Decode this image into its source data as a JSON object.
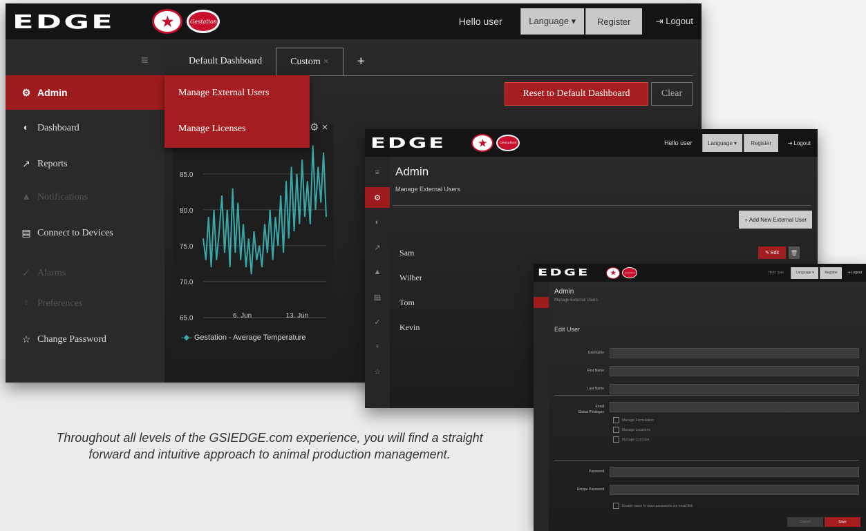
{
  "colors": {
    "accent": "#a51d21",
    "topbar": "#141414",
    "panel": "#262626"
  },
  "brand": {
    "logo": "EDGE",
    "badge_star": "★",
    "badge_oval": "Gestation"
  },
  "topbar": {
    "greeting": "Hello user",
    "language": "Language ▾",
    "register": "Register",
    "logout": "⇥ Logout"
  },
  "screen1": {
    "sidebar": [
      {
        "icon": "gear-icon",
        "glyph": "⚙",
        "label": "Admin"
      },
      {
        "icon": "dashboard-icon",
        "glyph": "◐",
        "label": "Dashboard"
      },
      {
        "icon": "reports-icon",
        "glyph": "↗",
        "label": "Reports"
      },
      {
        "icon": "notifications-icon",
        "glyph": "▲",
        "label": "Notifications"
      },
      {
        "icon": "devices-icon",
        "glyph": "▤",
        "label": "Connect to Devices"
      },
      {
        "icon": "alarm-icon",
        "glyph": "✓",
        "label": "Alarms"
      },
      {
        "icon": "preferences-icon",
        "glyph": "♀",
        "label": "Preferences"
      },
      {
        "icon": "star-icon",
        "glyph": "☆",
        "label": "Change Password"
      }
    ],
    "tabs": [
      "Default Dashboard",
      "Custom",
      "+"
    ],
    "tab_close": "×",
    "dropdown": [
      "Manage External Users",
      "Manage Licenses"
    ],
    "reset_label": "Reset to Default Dashboard",
    "clear_label": "Clear",
    "panel_icons": "⚙ ×"
  },
  "chart_data": {
    "type": "line",
    "y_ticks": [
      "85.0",
      "80.0",
      "75.0",
      "70.0",
      "65.0"
    ],
    "x_ticks": [
      "6. Jun",
      "13. Jun"
    ],
    "ylim": [
      64,
      90
    ],
    "legend": "Gestation - Average Temperature",
    "series": [
      {
        "name": "Gestation - Average Temperature",
        "values": [
          76,
          73,
          79,
          72,
          80,
          73,
          77,
          82,
          74,
          80,
          72,
          83,
          74,
          81,
          73,
          78,
          72,
          76,
          71,
          77,
          73,
          75,
          72,
          78,
          74,
          80,
          73,
          79,
          75,
          82,
          74,
          84,
          76,
          86,
          77,
          85,
          78,
          87,
          79,
          84,
          78,
          89,
          80,
          86,
          81,
          88,
          79
        ]
      }
    ]
  },
  "screen2": {
    "title": "Admin",
    "subtitle": "Manage External Users",
    "add_button": "+ Add New External User",
    "users": [
      "Sam",
      "Wilber",
      "Tom",
      "Kevin"
    ],
    "edit_label": "✎ Edit",
    "delete_label": "🗑"
  },
  "screen3": {
    "title": "Admin",
    "subtitle": "Manage External Users",
    "section": "Edit User",
    "fields": [
      "Username",
      "First Name",
      "Last Name",
      "Email"
    ],
    "privileges_label": "Global Privileges",
    "privileges": [
      "Manage Formulation",
      "Manage Locations",
      "Manage Licenses"
    ],
    "password": "Password",
    "retype": "Retype Password",
    "checkbox_note": "Enable users to reset passwords via email link",
    "cancel": "Cancel",
    "save": "Save"
  },
  "caption": "Throughout all levels of the GSIEDGE.com experience, you will find a straight forward and intuitive approach to animal production management."
}
